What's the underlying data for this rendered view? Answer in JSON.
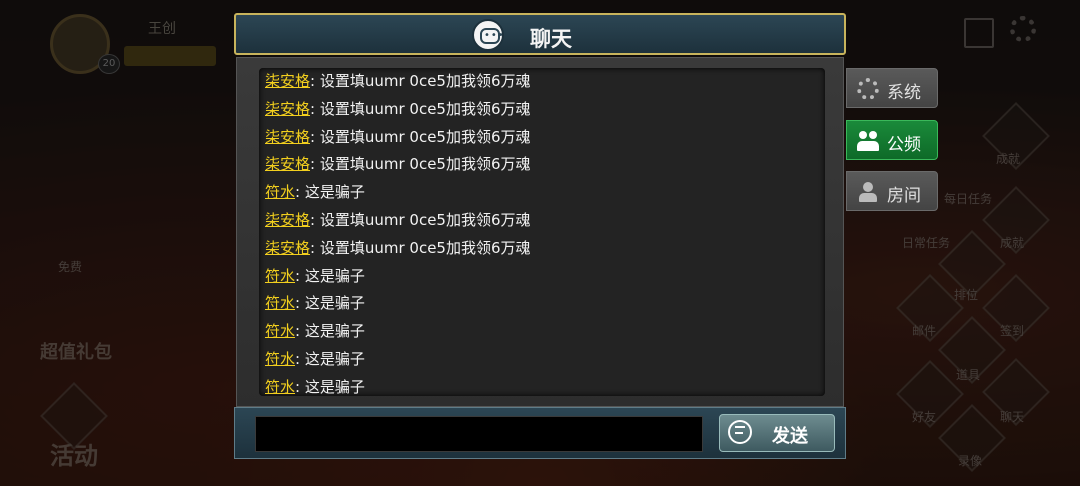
{
  "background": {
    "player_name": "王创",
    "player_level": "20",
    "left_labels": [
      "免费",
      "超值礼包",
      "活动"
    ],
    "right_labels": [
      "成就",
      "每日任务",
      "日常任务",
      "成就",
      "排位",
      "邮件",
      "签到",
      "道具",
      "好友",
      "聊天",
      "录像"
    ]
  },
  "chat": {
    "title": "聊天",
    "header_icon": "chat-bubble-icon",
    "messages": [
      {
        "sender": "柒安格",
        "text": ": 设置填uumr 0ce5加我领6万魂"
      },
      {
        "sender": "柒安格",
        "text": ": 设置填uumr 0ce5加我领6万魂"
      },
      {
        "sender": "柒安格",
        "text": ": 设置填uumr 0ce5加我领6万魂"
      },
      {
        "sender": "柒安格",
        "text": ": 设置填uumr 0ce5加我领6万魂"
      },
      {
        "sender": "符水",
        "text": ": 这是骗子"
      },
      {
        "sender": "柒安格",
        "text": ": 设置填uumr 0ce5加我领6万魂"
      },
      {
        "sender": "柒安格",
        "text": ": 设置填uumr 0ce5加我领6万魂"
      },
      {
        "sender": "符水",
        "text": ": 这是骗子"
      },
      {
        "sender": "符水",
        "text": ": 这是骗子"
      },
      {
        "sender": "符水",
        "text": ": 这是骗子"
      },
      {
        "sender": "符水",
        "text": ": 这是骗子"
      },
      {
        "sender": "符水",
        "text": ": 这是骗子"
      }
    ],
    "input": {
      "value": "",
      "placeholder": ""
    },
    "send_label": "发送"
  },
  "tabs": [
    {
      "label": "系统",
      "icon": "gear-icon",
      "active": false
    },
    {
      "label": "公频",
      "icon": "people-icon",
      "active": true
    },
    {
      "label": "房间",
      "icon": "person-icon",
      "active": false
    }
  ],
  "colors": {
    "sender": "#f2cf1e",
    "active_tab": "#1a8a3a",
    "panel_border": "#c8b45c"
  }
}
